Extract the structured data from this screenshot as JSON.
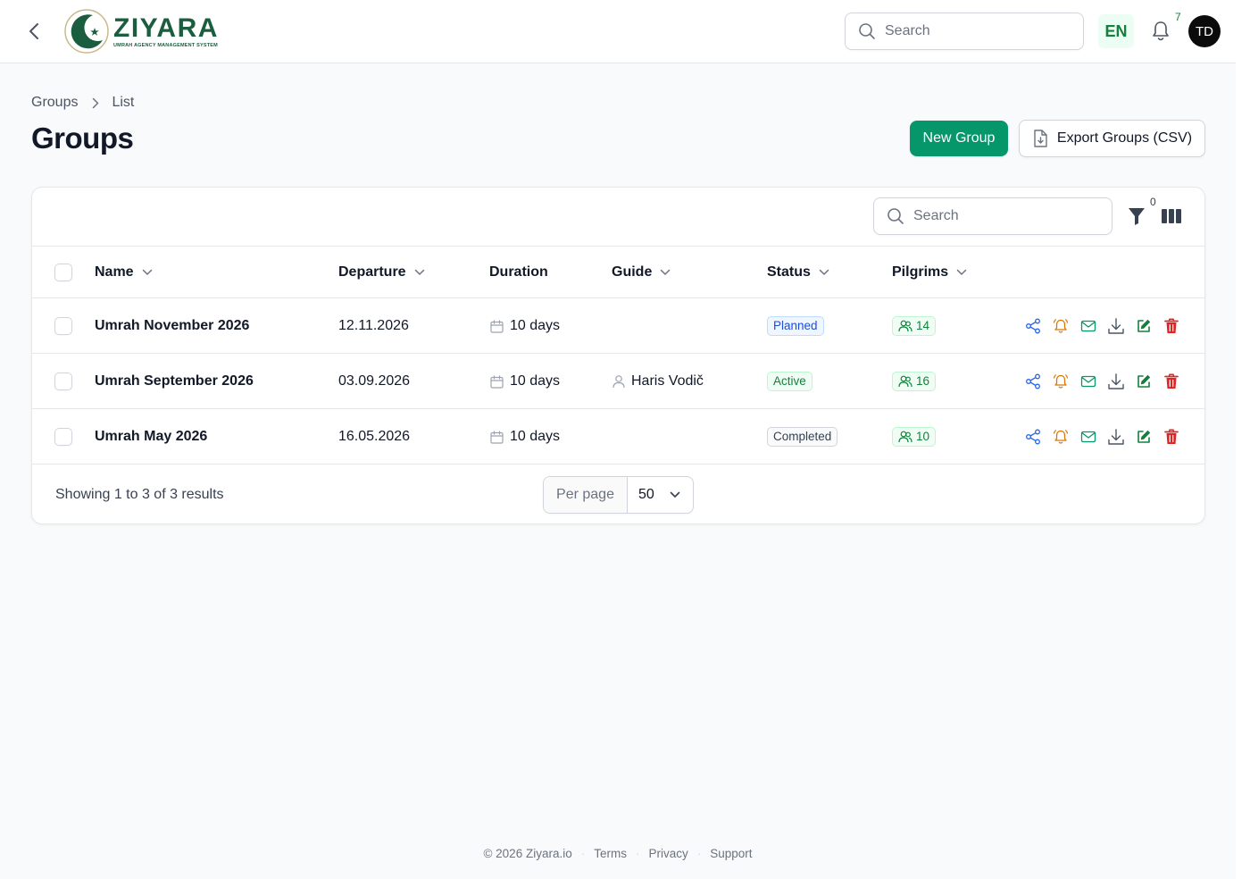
{
  "brand": {
    "name": "ZIYARA",
    "tagline": "UMRAH AGENCY MANAGEMENT SYSTEM",
    "accent": "#059669",
    "brand_green": "#1b5e3f"
  },
  "topbar": {
    "search_placeholder": "Search",
    "language": "EN",
    "notifications_count": "7",
    "avatar_initials": "TD"
  },
  "breadcrumb": {
    "items": [
      "Groups",
      "List"
    ]
  },
  "page": {
    "title": "Groups",
    "new_button": "New Group",
    "export_button": "Export Groups (CSV)"
  },
  "table": {
    "search_placeholder": "Search",
    "filter_count": "0",
    "columns": {
      "name": "Name",
      "departure": "Departure",
      "duration": "Duration",
      "guide": "Guide",
      "status": "Status",
      "pilgrims": "Pilgrims"
    },
    "rows": [
      {
        "name": "Umrah November 2026",
        "departure": "12.11.2026",
        "duration": "10 days",
        "guide": "",
        "status": "Planned",
        "pilgrims": "14"
      },
      {
        "name": "Umrah September 2026",
        "departure": "03.09.2026",
        "duration": "10 days",
        "guide": "Haris Vodič",
        "status": "Active",
        "pilgrims": "16"
      },
      {
        "name": "Umrah May 2026",
        "departure": "16.05.2026",
        "duration": "10 days",
        "guide": "",
        "status": "Completed",
        "pilgrims": "10"
      }
    ],
    "action_icons": [
      "share-icon",
      "bell-icon",
      "mail-icon",
      "download-icon",
      "edit-icon",
      "delete-icon"
    ],
    "showing_text": "Showing 1 to 3 of 3 results",
    "per_page_label": "Per page",
    "per_page_value": "50"
  },
  "footer": {
    "copyright": "© 2026 Ziyara.io",
    "links": [
      "Terms",
      "Privacy",
      "Support"
    ]
  }
}
